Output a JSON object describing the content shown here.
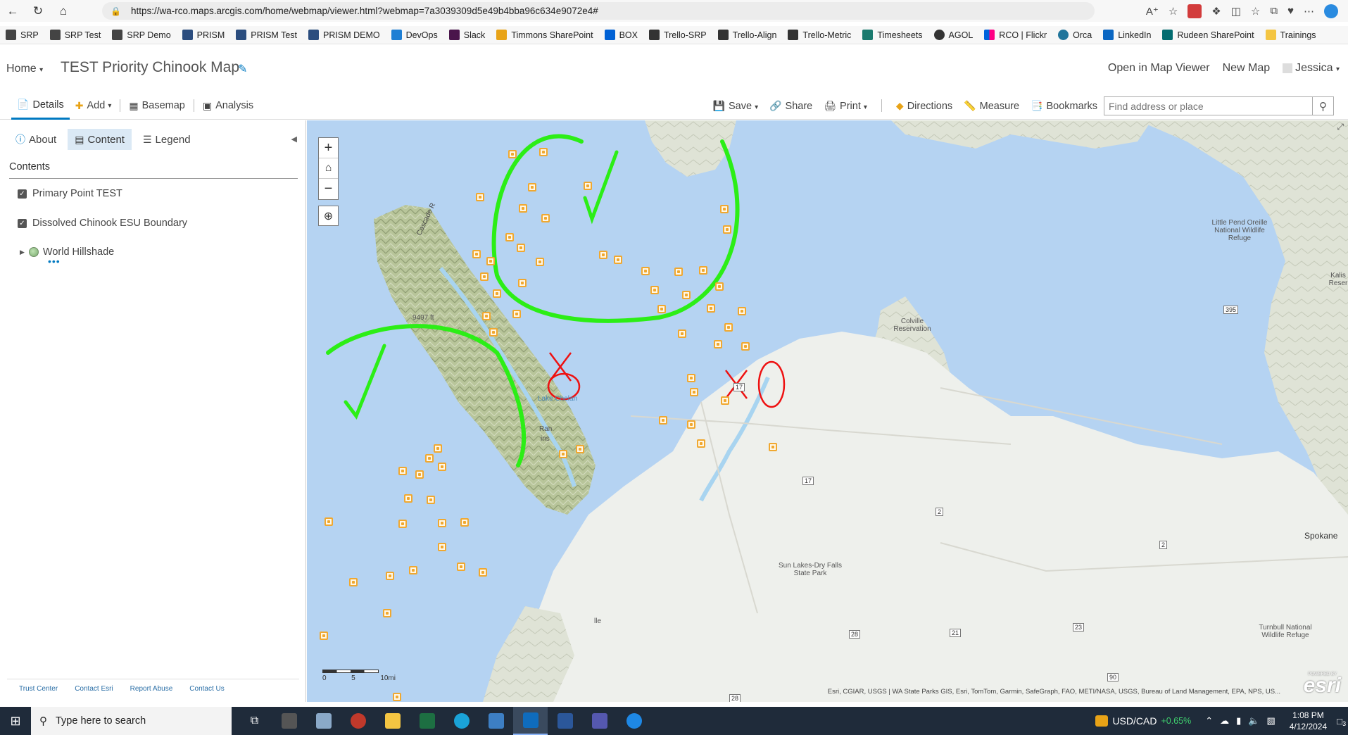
{
  "browser": {
    "url": "https://wa-rco.maps.arcgis.com/home/webmap/viewer.html?webmap=7a3039309d5e49b4bba96c634e9072e4#",
    "bookmarks": [
      "SRP",
      "SRP Test",
      "SRP Demo",
      "PRISM",
      "PRISM Test",
      "PRISM DEMO",
      "DevOps",
      "Slack",
      "Timmons SharePoint",
      "BOX",
      "Trello-SRP",
      "Trello-Align",
      "Trello-Metric",
      "Timesheets",
      "AGOL",
      "RCO | Flickr",
      "Orca",
      "LinkedIn",
      "Rudeen SharePoint",
      "Trainings"
    ]
  },
  "header": {
    "home_label": "Home",
    "map_title": "TEST Priority Chinook Map",
    "open_in_map_viewer": "Open in Map Viewer",
    "new_map": "New Map",
    "user": "Jessica"
  },
  "toolbar": {
    "details": "Details",
    "add": "Add",
    "basemap": "Basemap",
    "analysis": "Analysis",
    "save": "Save",
    "share": "Share",
    "print": "Print",
    "directions": "Directions",
    "measure": "Measure",
    "bookmarks": "Bookmarks",
    "search_placeholder": "Find address or place"
  },
  "panel": {
    "tabs": [
      "About",
      "Content",
      "Legend"
    ],
    "contents_label": "Contents",
    "layers": [
      {
        "name": "Primary Point TEST",
        "checked": true
      },
      {
        "name": "Dissolved Chinook ESU Boundary",
        "checked": true
      },
      {
        "name": "World Hillshade",
        "checked": false
      }
    ],
    "footer_links": [
      "Trust Center",
      "Contact Esri",
      "Report Abuse",
      "Contact Us"
    ]
  },
  "map": {
    "labels": {
      "little_pend": "Little Pend Oreille National Wildlife Refuge",
      "colville": "Colville Reservation",
      "sun_lakes": "Sun Lakes-Dry Falls State Park",
      "spokane": "Spokane",
      "lake_chelan": "Lake Chelan",
      "cascade": "Cascade R",
      "elevation": "9497 ft",
      "turnbull": "Turnbull National Wildlife Refuge",
      "kalis": "Kalis Reser",
      "ran": "Ran",
      "ins": "ins",
      "lle": "lle"
    },
    "highways": [
      "17",
      "17",
      "2",
      "2",
      "395",
      "28",
      "21",
      "23",
      "90",
      "28"
    ],
    "scale_labels": [
      "0",
      "5",
      "10mi"
    ],
    "attribution": "Esri, CGIAR, USGS | WA State Parks GIS, Esri, TomTom, Garmin, SafeGraph, FAO, METI/NASA, USGS, Bureau of Land Management, EPA, NPS, US...",
    "esri": "esri",
    "powered_by": "POWERED BY"
  },
  "taskbar": {
    "search_placeholder": "Type here to search",
    "currency": "USD/CAD",
    "change": "+0.65%",
    "time": "1:08 PM",
    "date": "4/12/2024",
    "notifications": "3"
  }
}
